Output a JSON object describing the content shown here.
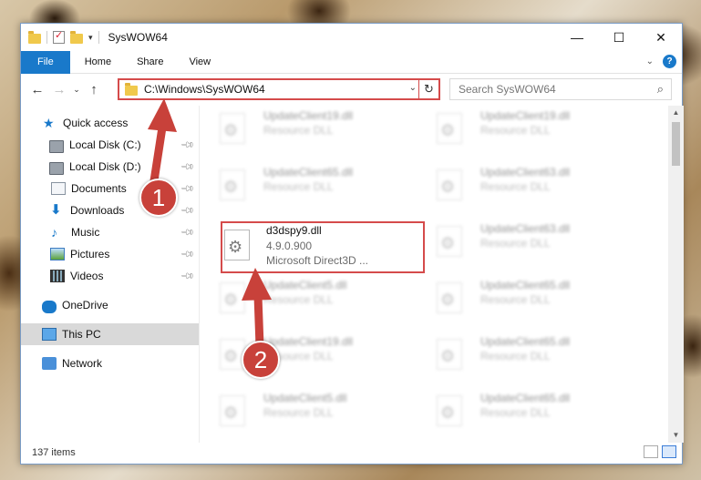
{
  "window": {
    "title": "SysWOW64",
    "controls": [
      "—",
      "☐",
      "✕"
    ]
  },
  "ribbon": {
    "tabs": [
      "File",
      "Home",
      "Share",
      "View"
    ],
    "help": "?"
  },
  "nav": {
    "back": "←",
    "forward": "→",
    "recent": "⌄",
    "up": "↑",
    "address": "C:\\Windows\\SysWOW64",
    "search_placeholder": "Search SysWOW64"
  },
  "sidebar": {
    "items": [
      {
        "label": "Quick access",
        "icon": "star-icon"
      },
      {
        "label": "Local Disk (C:)",
        "icon": "drive-icon",
        "pinned": true
      },
      {
        "label": "Local Disk (D:)",
        "icon": "drive-icon",
        "pinned": true
      },
      {
        "label": "Documents",
        "icon": "documents-icon",
        "pinned": true
      },
      {
        "label": "Downloads",
        "icon": "downloads-icon",
        "pinned": true
      },
      {
        "label": "Music",
        "icon": "music-icon",
        "pinned": true
      },
      {
        "label": "Pictures",
        "icon": "pictures-icon",
        "pinned": true
      },
      {
        "label": "Videos",
        "icon": "videos-icon",
        "pinned": true
      },
      {
        "label": "OneDrive",
        "icon": "onedrive-icon"
      },
      {
        "label": "This PC",
        "icon": "computer-icon",
        "selected": true
      },
      {
        "label": "Network",
        "icon": "network-icon"
      }
    ]
  },
  "files": {
    "items": [
      {
        "name": "UpdateClient19.dll",
        "type": "Resource DLL",
        "blurred": true
      },
      {
        "name": "UpdateClient19.dll",
        "type": "Resource DLL",
        "blurred": true
      },
      {
        "name": "UpdateClient65.dll",
        "type": "Resource DLL",
        "blurred": true
      },
      {
        "name": "UpdateClient63.dll",
        "type": "Resource DLL",
        "blurred": true
      },
      {
        "name": "d3dspy9.dll",
        "version": "4.9.0.900",
        "description": "Microsoft Direct3D ...",
        "blurred": false
      },
      {
        "name": "UpdateClient63.dll",
        "type": "Resource DLL",
        "blurred": true
      },
      {
        "name": "UpdateClient5.dll",
        "type": "Resource DLL",
        "blurred": true
      },
      {
        "name": "UpdateClient65.dll",
        "type": "Resource DLL",
        "blurred": true
      },
      {
        "name": "UpdateClient19.dll",
        "type": "Resource DLL",
        "blurred": true
      },
      {
        "name": "UpdateClient65.dll",
        "type": "Resource DLL",
        "blurred": true
      },
      {
        "name": "UpdateClient5.dll",
        "type": "Resource DLL",
        "blurred": true
      },
      {
        "name": "UpdateClient65.dll",
        "type": "Resource DLL",
        "blurred": true
      }
    ]
  },
  "status": {
    "item_count": "137 items"
  },
  "annotations": {
    "step1": "1",
    "step2": "2",
    "color": "#c8413a"
  }
}
